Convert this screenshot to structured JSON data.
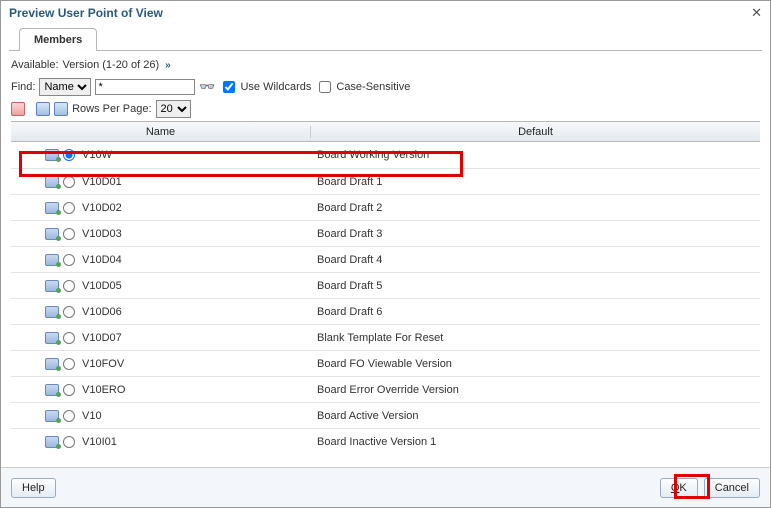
{
  "title": "Preview User Point of View",
  "tab_label": "Members",
  "available": {
    "label": "Available:",
    "value": "Version (1-20 of 26)"
  },
  "find": {
    "label": "Find:",
    "field_options": [
      "Name"
    ],
    "field_selected": "Name",
    "value": "*"
  },
  "wildcards": {
    "label": "Use Wildcards",
    "checked": true
  },
  "case_sensitive": {
    "label": "Case-Sensitive",
    "checked": false
  },
  "rows_per_page": {
    "label": "Rows Per Page:",
    "options": [
      "20"
    ],
    "selected": "20"
  },
  "columns": {
    "name": "Name",
    "default": "Default"
  },
  "rows": [
    {
      "code": "V10W",
      "desc": "Board Working Version",
      "selected": true
    },
    {
      "code": "V10D01",
      "desc": "Board Draft 1",
      "selected": false
    },
    {
      "code": "V10D02",
      "desc": "Board Draft 2",
      "selected": false
    },
    {
      "code": "V10D03",
      "desc": "Board Draft 3",
      "selected": false
    },
    {
      "code": "V10D04",
      "desc": "Board Draft 4",
      "selected": false
    },
    {
      "code": "V10D05",
      "desc": "Board Draft 5",
      "selected": false
    },
    {
      "code": "V10D06",
      "desc": "Board Draft 6",
      "selected": false
    },
    {
      "code": "V10D07",
      "desc": "Blank Template For Reset",
      "selected": false
    },
    {
      "code": "V10FOV",
      "desc": "Board FO Viewable Version",
      "selected": false
    },
    {
      "code": "V10ERO",
      "desc": "Board Error Override Version",
      "selected": false
    },
    {
      "code": "V10",
      "desc": "Board Active Version",
      "selected": false
    },
    {
      "code": "V10I01",
      "desc": "Board Inactive Version 1",
      "selected": false
    }
  ],
  "buttons": {
    "help": "Help",
    "ok": "OK",
    "cancel": "Cancel"
  }
}
